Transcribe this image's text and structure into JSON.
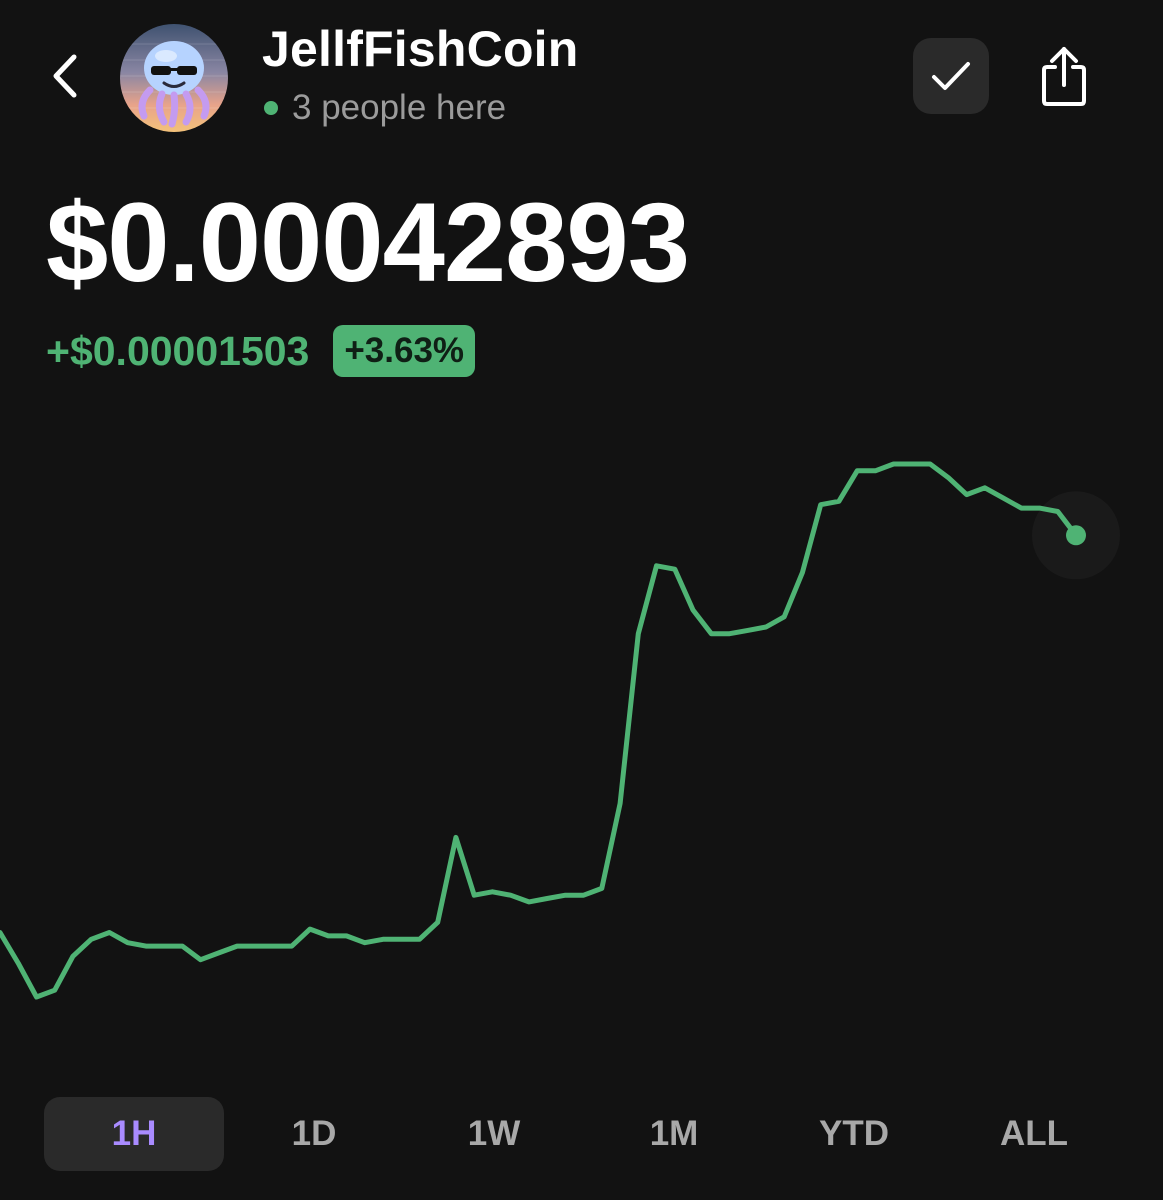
{
  "header": {
    "coin_name": "JellfFishCoin",
    "presence_text": "3 people here"
  },
  "price": {
    "current": "$0.00042893",
    "change_abs": "+$0.00001503",
    "change_pct": "+3.63%"
  },
  "colors": {
    "background": "#121212",
    "accent_green": "#4fb374",
    "active_tab": "#a98bff",
    "button_bg": "#2a2a2a"
  },
  "icons": {
    "back": "chevron-left-icon",
    "avatar": "jellyfish-avatar-icon",
    "check": "check-icon",
    "share": "share-icon"
  },
  "time_ranges": {
    "selected": "1H",
    "labels": [
      "1H",
      "1D",
      "1W",
      "1M",
      "YTD",
      "ALL"
    ]
  },
  "chart_data": {
    "type": "line",
    "title": "",
    "xlabel": "",
    "ylabel": "",
    "grid": false,
    "series": [
      {
        "values": [
          0.0004137,
          0.0004128,
          0.0004118,
          0.000412,
          0.000413,
          0.0004135,
          0.0004137,
          0.0004134,
          0.0004133,
          0.0004133,
          0.0004133,
          0.0004129,
          0.0004131,
          0.0004133,
          0.0004133,
          0.0004133,
          0.0004133,
          0.0004138,
          0.0004136,
          0.0004136,
          0.0004134,
          0.0004135,
          0.0004135,
          0.0004135,
          0.000414,
          0.0004165,
          0.0004148,
          0.0004149,
          0.0004148,
          0.0004146,
          0.0004147,
          0.0004148,
          0.0004148,
          0.000415,
          0.0004175,
          0.0004225,
          0.0004245,
          0.0004244,
          0.0004232,
          0.0004225,
          0.0004225,
          0.0004226,
          0.0004227,
          0.000423,
          0.0004243,
          0.0004263,
          0.0004264,
          0.0004273,
          0.0004273,
          0.0004275,
          0.0004275,
          0.0004275,
          0.0004271,
          0.0004266,
          0.0004268,
          0.0004265,
          0.0004262,
          0.0004262,
          0.0004261,
          0.0004254
        ]
      }
    ]
  }
}
